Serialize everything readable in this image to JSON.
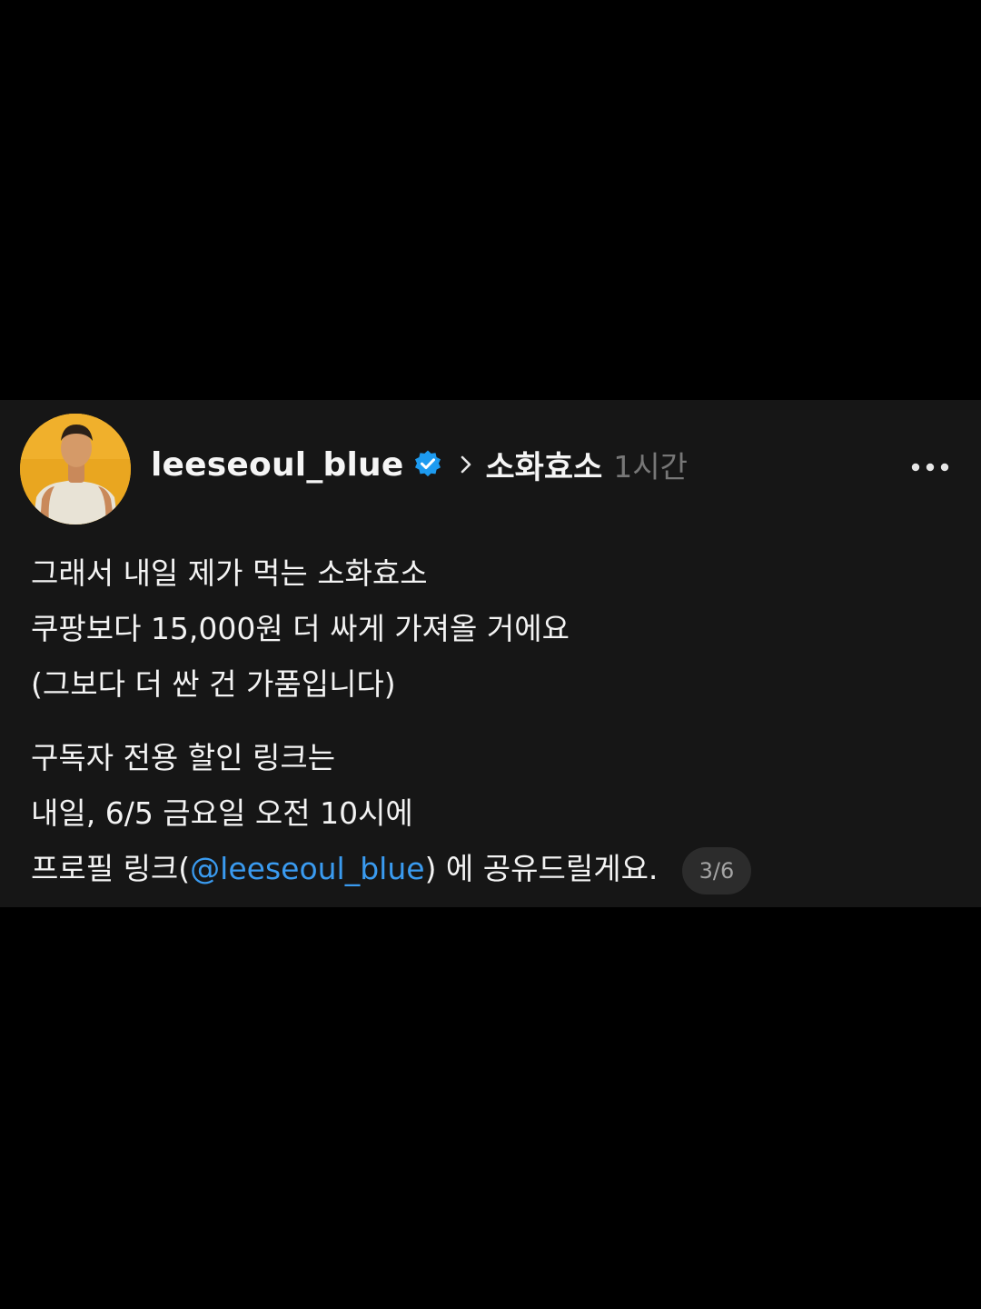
{
  "post": {
    "username": "leeseoul_blue",
    "topic": "소화효소",
    "time": "1시간",
    "body": {
      "line1": "그래서 내일 제가 먹는 소화효소",
      "line2": "쿠팡보다 15,000원 더 싸게 가져올 거에요",
      "line3": "(그보다 더 싼 건 가품입니다)",
      "line4": "구독자 전용 할인 링크는",
      "line5": "내일, 6/5 금요일 오전 10시에",
      "line6_prefix": "프로필 링크(",
      "line6_mention": "@leeseoul_blue",
      "line6_suffix": ") 에 공유드릴게요."
    },
    "page_indicator": "3/6"
  },
  "icons": {
    "verified": "verified-badge-icon",
    "chevron": "chevron-right-icon",
    "more": "more-horizontal-icon"
  },
  "colors": {
    "background": "#000000",
    "card": "#161616",
    "text": "#f3f3f3",
    "muted": "#777777",
    "mention": "#3a9bf0",
    "verified": "#1d9bf0",
    "avatar_bg": "#e9a620"
  }
}
